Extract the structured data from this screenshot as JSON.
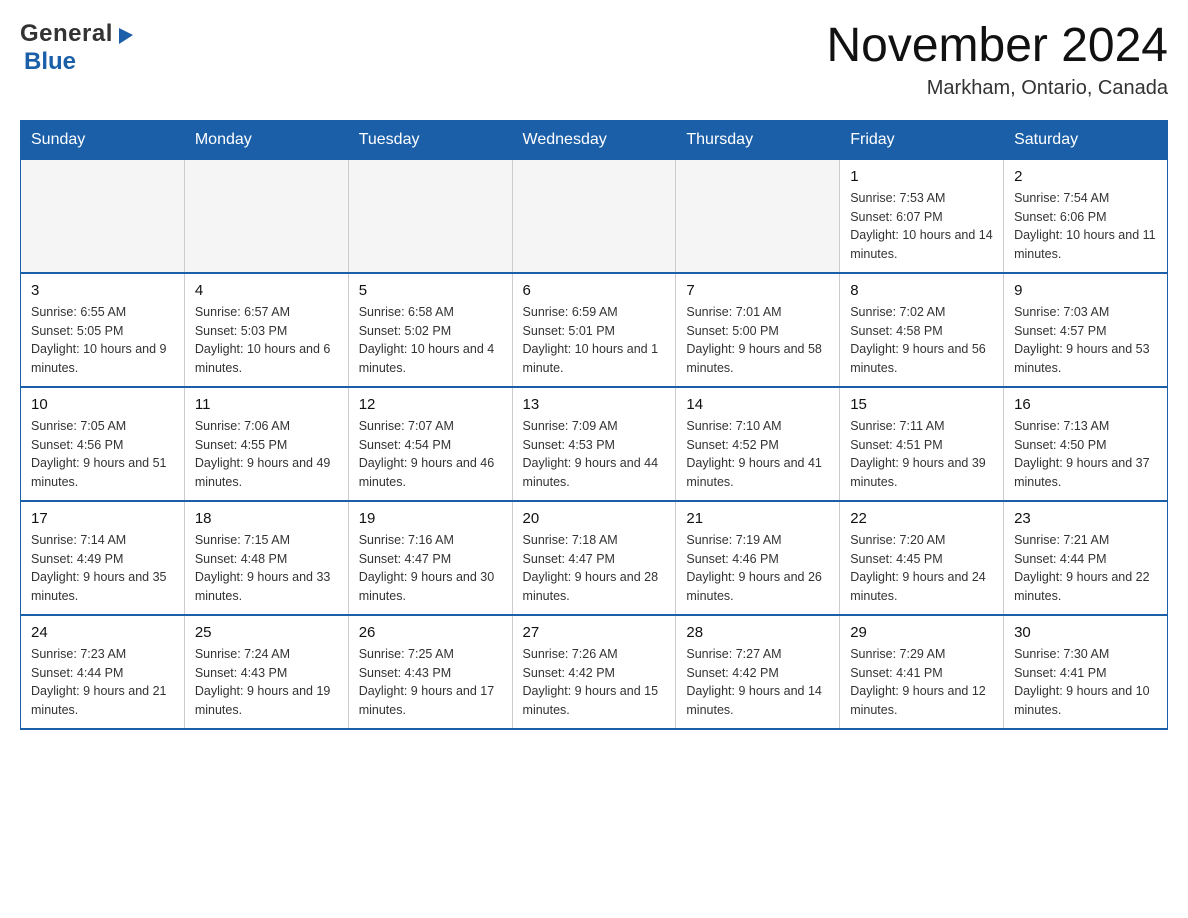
{
  "logo": {
    "general": "General",
    "triangle": "▶",
    "blue": "Blue"
  },
  "title": "November 2024",
  "subtitle": "Markham, Ontario, Canada",
  "weekdays": [
    "Sunday",
    "Monday",
    "Tuesday",
    "Wednesday",
    "Thursday",
    "Friday",
    "Saturday"
  ],
  "weeks": [
    [
      {
        "day": "",
        "info": ""
      },
      {
        "day": "",
        "info": ""
      },
      {
        "day": "",
        "info": ""
      },
      {
        "day": "",
        "info": ""
      },
      {
        "day": "",
        "info": ""
      },
      {
        "day": "1",
        "info": "Sunrise: 7:53 AM\nSunset: 6:07 PM\nDaylight: 10 hours and 14 minutes."
      },
      {
        "day": "2",
        "info": "Sunrise: 7:54 AM\nSunset: 6:06 PM\nDaylight: 10 hours and 11 minutes."
      }
    ],
    [
      {
        "day": "3",
        "info": "Sunrise: 6:55 AM\nSunset: 5:05 PM\nDaylight: 10 hours and 9 minutes."
      },
      {
        "day": "4",
        "info": "Sunrise: 6:57 AM\nSunset: 5:03 PM\nDaylight: 10 hours and 6 minutes."
      },
      {
        "day": "5",
        "info": "Sunrise: 6:58 AM\nSunset: 5:02 PM\nDaylight: 10 hours and 4 minutes."
      },
      {
        "day": "6",
        "info": "Sunrise: 6:59 AM\nSunset: 5:01 PM\nDaylight: 10 hours and 1 minute."
      },
      {
        "day": "7",
        "info": "Sunrise: 7:01 AM\nSunset: 5:00 PM\nDaylight: 9 hours and 58 minutes."
      },
      {
        "day": "8",
        "info": "Sunrise: 7:02 AM\nSunset: 4:58 PM\nDaylight: 9 hours and 56 minutes."
      },
      {
        "day": "9",
        "info": "Sunrise: 7:03 AM\nSunset: 4:57 PM\nDaylight: 9 hours and 53 minutes."
      }
    ],
    [
      {
        "day": "10",
        "info": "Sunrise: 7:05 AM\nSunset: 4:56 PM\nDaylight: 9 hours and 51 minutes."
      },
      {
        "day": "11",
        "info": "Sunrise: 7:06 AM\nSunset: 4:55 PM\nDaylight: 9 hours and 49 minutes."
      },
      {
        "day": "12",
        "info": "Sunrise: 7:07 AM\nSunset: 4:54 PM\nDaylight: 9 hours and 46 minutes."
      },
      {
        "day": "13",
        "info": "Sunrise: 7:09 AM\nSunset: 4:53 PM\nDaylight: 9 hours and 44 minutes."
      },
      {
        "day": "14",
        "info": "Sunrise: 7:10 AM\nSunset: 4:52 PM\nDaylight: 9 hours and 41 minutes."
      },
      {
        "day": "15",
        "info": "Sunrise: 7:11 AM\nSunset: 4:51 PM\nDaylight: 9 hours and 39 minutes."
      },
      {
        "day": "16",
        "info": "Sunrise: 7:13 AM\nSunset: 4:50 PM\nDaylight: 9 hours and 37 minutes."
      }
    ],
    [
      {
        "day": "17",
        "info": "Sunrise: 7:14 AM\nSunset: 4:49 PM\nDaylight: 9 hours and 35 minutes."
      },
      {
        "day": "18",
        "info": "Sunrise: 7:15 AM\nSunset: 4:48 PM\nDaylight: 9 hours and 33 minutes."
      },
      {
        "day": "19",
        "info": "Sunrise: 7:16 AM\nSunset: 4:47 PM\nDaylight: 9 hours and 30 minutes."
      },
      {
        "day": "20",
        "info": "Sunrise: 7:18 AM\nSunset: 4:47 PM\nDaylight: 9 hours and 28 minutes."
      },
      {
        "day": "21",
        "info": "Sunrise: 7:19 AM\nSunset: 4:46 PM\nDaylight: 9 hours and 26 minutes."
      },
      {
        "day": "22",
        "info": "Sunrise: 7:20 AM\nSunset: 4:45 PM\nDaylight: 9 hours and 24 minutes."
      },
      {
        "day": "23",
        "info": "Sunrise: 7:21 AM\nSunset: 4:44 PM\nDaylight: 9 hours and 22 minutes."
      }
    ],
    [
      {
        "day": "24",
        "info": "Sunrise: 7:23 AM\nSunset: 4:44 PM\nDaylight: 9 hours and 21 minutes."
      },
      {
        "day": "25",
        "info": "Sunrise: 7:24 AM\nSunset: 4:43 PM\nDaylight: 9 hours and 19 minutes."
      },
      {
        "day": "26",
        "info": "Sunrise: 7:25 AM\nSunset: 4:43 PM\nDaylight: 9 hours and 17 minutes."
      },
      {
        "day": "27",
        "info": "Sunrise: 7:26 AM\nSunset: 4:42 PM\nDaylight: 9 hours and 15 minutes."
      },
      {
        "day": "28",
        "info": "Sunrise: 7:27 AM\nSunset: 4:42 PM\nDaylight: 9 hours and 14 minutes."
      },
      {
        "day": "29",
        "info": "Sunrise: 7:29 AM\nSunset: 4:41 PM\nDaylight: 9 hours and 12 minutes."
      },
      {
        "day": "30",
        "info": "Sunrise: 7:30 AM\nSunset: 4:41 PM\nDaylight: 9 hours and 10 minutes."
      }
    ]
  ]
}
